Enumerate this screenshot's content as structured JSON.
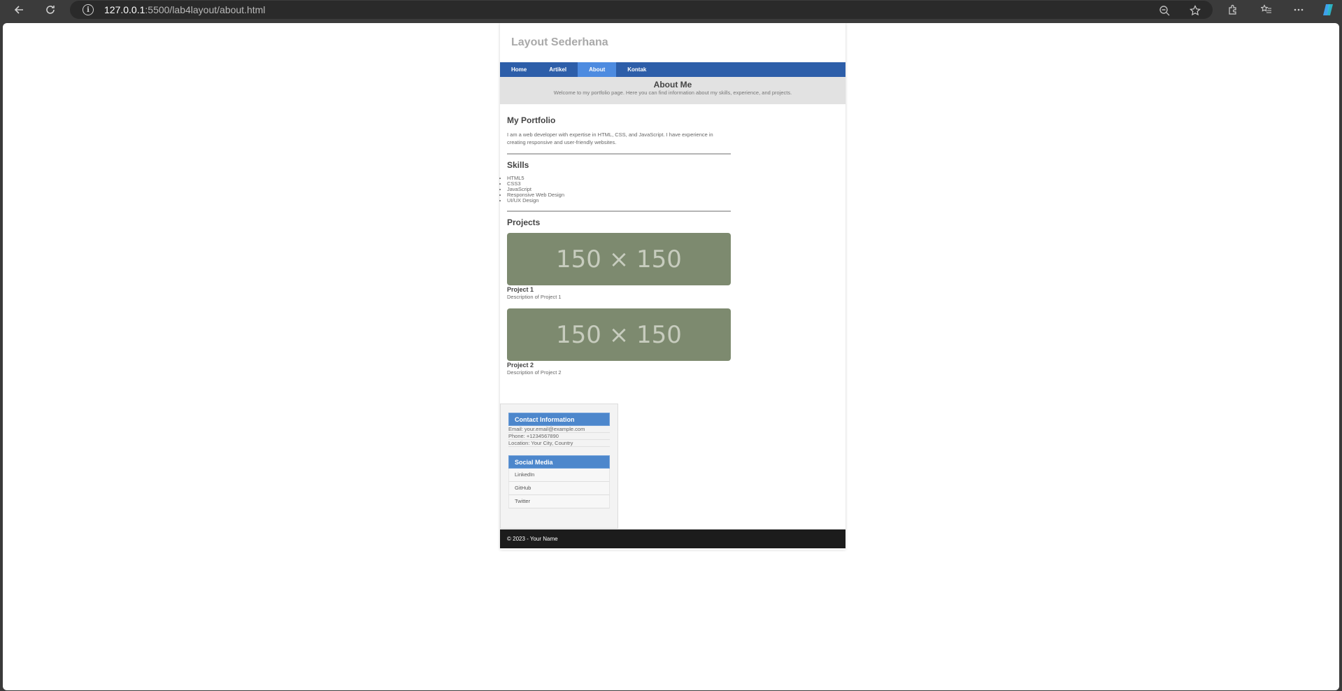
{
  "browser": {
    "url_host": "127.0.0.1",
    "url_rest": ":5500/lab4layout/about.html"
  },
  "site": {
    "title": "Layout Sederhana",
    "nav": [
      {
        "label": "Home"
      },
      {
        "label": "Artikel"
      },
      {
        "label": "About"
      },
      {
        "label": "Kontak"
      }
    ],
    "banner_title": "About Me",
    "banner_subtitle": "Welcome to my portfolio page. Here you can find information about my skills, experience, and projects."
  },
  "portfolio": {
    "heading": "My Portfolio",
    "text": "I am a web developer with expertise in HTML, CSS, and JavaScript. I have experience in creating responsive and user-friendly websites."
  },
  "skills": {
    "heading": "Skills",
    "items": [
      "HTML5",
      "CSS3",
      "JavaScript",
      "Responsive Web Design",
      "UI/UX Design"
    ]
  },
  "projects": {
    "heading": "Projects",
    "items": [
      {
        "image_text": "150 × 150",
        "title": "Project 1",
        "desc": "Description of Project 1"
      },
      {
        "image_text": "150 × 150",
        "title": "Project 2",
        "desc": "Description of Project 2"
      }
    ]
  },
  "sidebar": {
    "contact_heading": "Contact Information",
    "contact": [
      "Email: your.email@example.com",
      "Phone: +1234567890",
      "Location: Your City, Country"
    ],
    "social_heading": "Social Media",
    "social": [
      "LinkedIn",
      "GitHub",
      "Twitter"
    ]
  },
  "footer": {
    "text": "© 2023 - Your Name"
  },
  "colors": {
    "nav_bg": "#2d5ea9",
    "nav_active": "#4d8be0",
    "widget_header": "#4d87cc",
    "footer_bg": "#1c1c1c",
    "placeholder_bg": "#7d8a6f"
  }
}
